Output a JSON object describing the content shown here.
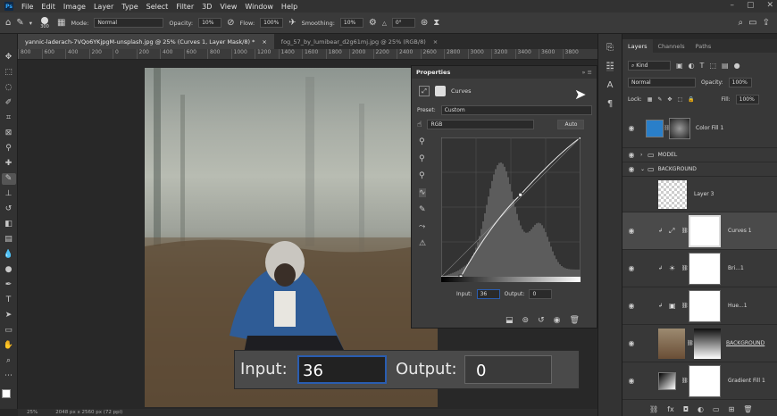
{
  "menu": {
    "app_icon": "Ps",
    "items": [
      "File",
      "Edit",
      "Image",
      "Layer",
      "Type",
      "Select",
      "Filter",
      "3D",
      "View",
      "Window",
      "Help"
    ],
    "window_controls": [
      "–",
      "▢",
      "✕"
    ]
  },
  "options": {
    "brush_size": "300",
    "mode_label": "Mode:",
    "mode_value": "Normal",
    "opacity_label": "Opacity:",
    "opacity_value": "10%",
    "flow_label": "Flow:",
    "flow_value": "100%",
    "smoothing_label": "Smoothing:",
    "smoothing_value": "10%",
    "angle_value": "0°"
  },
  "tabs": [
    {
      "label": "yannic-laderach-7VQo6YKjpgM-unsplash.jpg @ 25% (Curves 1, Layer Mask/8) *",
      "close": "×"
    },
    {
      "label": "fog_57_by_lumibear_d2g61mj.jpg @ 25% (RGB/8)",
      "close": "×"
    }
  ],
  "ruler": [
    "800",
    "600",
    "400",
    "200",
    "0",
    "200",
    "400",
    "600",
    "800",
    "1000",
    "1200",
    "1400",
    "1600",
    "1800",
    "2000",
    "2200",
    "2400",
    "2600",
    "2800",
    "3000",
    "3200",
    "3400",
    "3600",
    "3800",
    "4000"
  ],
  "status": {
    "zoom": "25%",
    "size": "2048 px x 2560 px (72 ppi)"
  },
  "properties": {
    "title": "Properties",
    "panel_name": "Curves",
    "preset_label": "Preset:",
    "preset_value": "Custom",
    "channel_value": "RGB",
    "auto_label": "Auto",
    "input_label": "Input:",
    "input_value": "36",
    "output_label": "Output:",
    "output_value": "0"
  },
  "zoom_readout": {
    "input_label": "Input:",
    "input_value": "36",
    "output_label": "Output:",
    "output_value": "0"
  },
  "layers_panel": {
    "tabs": [
      "Layers",
      "Channels",
      "Paths"
    ],
    "kind_label": "Kind",
    "blend_mode": "Normal",
    "opacity_label": "Opacity:",
    "opacity_value": "100%",
    "lock_label": "Lock:",
    "fill_label": "Fill:",
    "fill_value": "100%",
    "layers": [
      {
        "name": "Color Fill 1"
      },
      {
        "name": "MODEL"
      },
      {
        "name": "BACKGROUND"
      },
      {
        "name": "Layer 3"
      },
      {
        "name": "Curves 1"
      },
      {
        "name": "Bri...1"
      },
      {
        "name": "Hue...1"
      },
      {
        "name": "BACKGROUND"
      },
      {
        "name": "Gradient Fill 1"
      }
    ]
  },
  "curve": {
    "points": [
      [
        36,
        0
      ],
      [
        145,
        150
      ],
      [
        255,
        255
      ]
    ]
  }
}
